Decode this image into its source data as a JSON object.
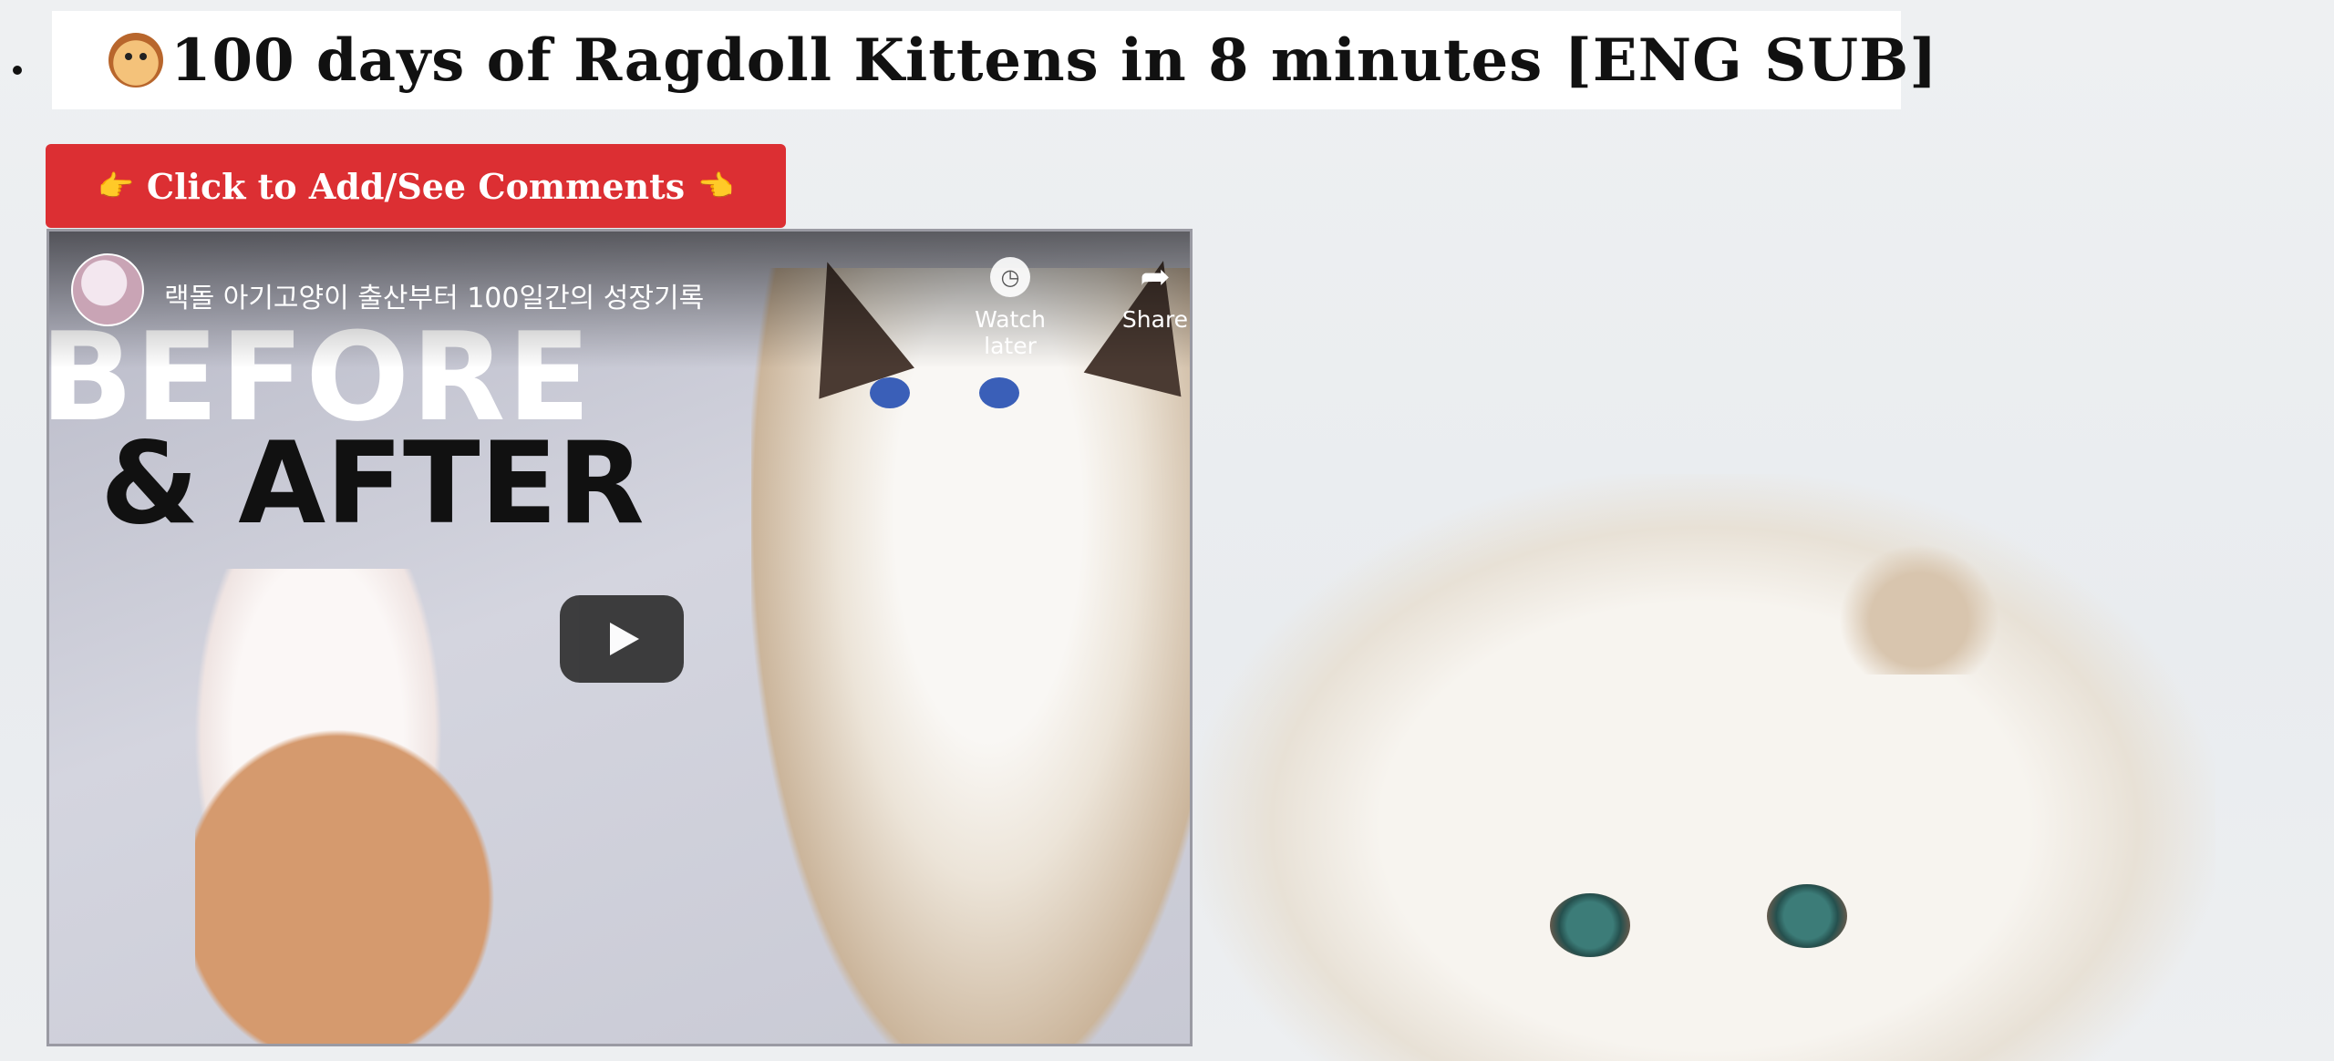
{
  "page": {
    "title": "100 days of Ragdoll Kittens in 8 minutes [ENG SUB]",
    "title_emoji": "dog-face-emoji"
  },
  "comments_button": {
    "label": "Click to Add/See Comments",
    "left_icon": "pointing-right-hand-emoji",
    "right_icon": "pointing-left-hand-emoji",
    "left_glyph": "👉",
    "right_glyph": "👈",
    "color": "#dc2f33"
  },
  "video": {
    "title": "랙돌 아기고양이 출산부터 100일간의 성장기록",
    "watch_later_label": "Watch later",
    "share_label": "Share",
    "thumbnail_text_1": "BEFORE",
    "thumbnail_text_2": "& AFTER",
    "play_icon": "play-icon",
    "watch_later_icon": "clock-icon",
    "share_icon": "share-arrow-icon"
  }
}
